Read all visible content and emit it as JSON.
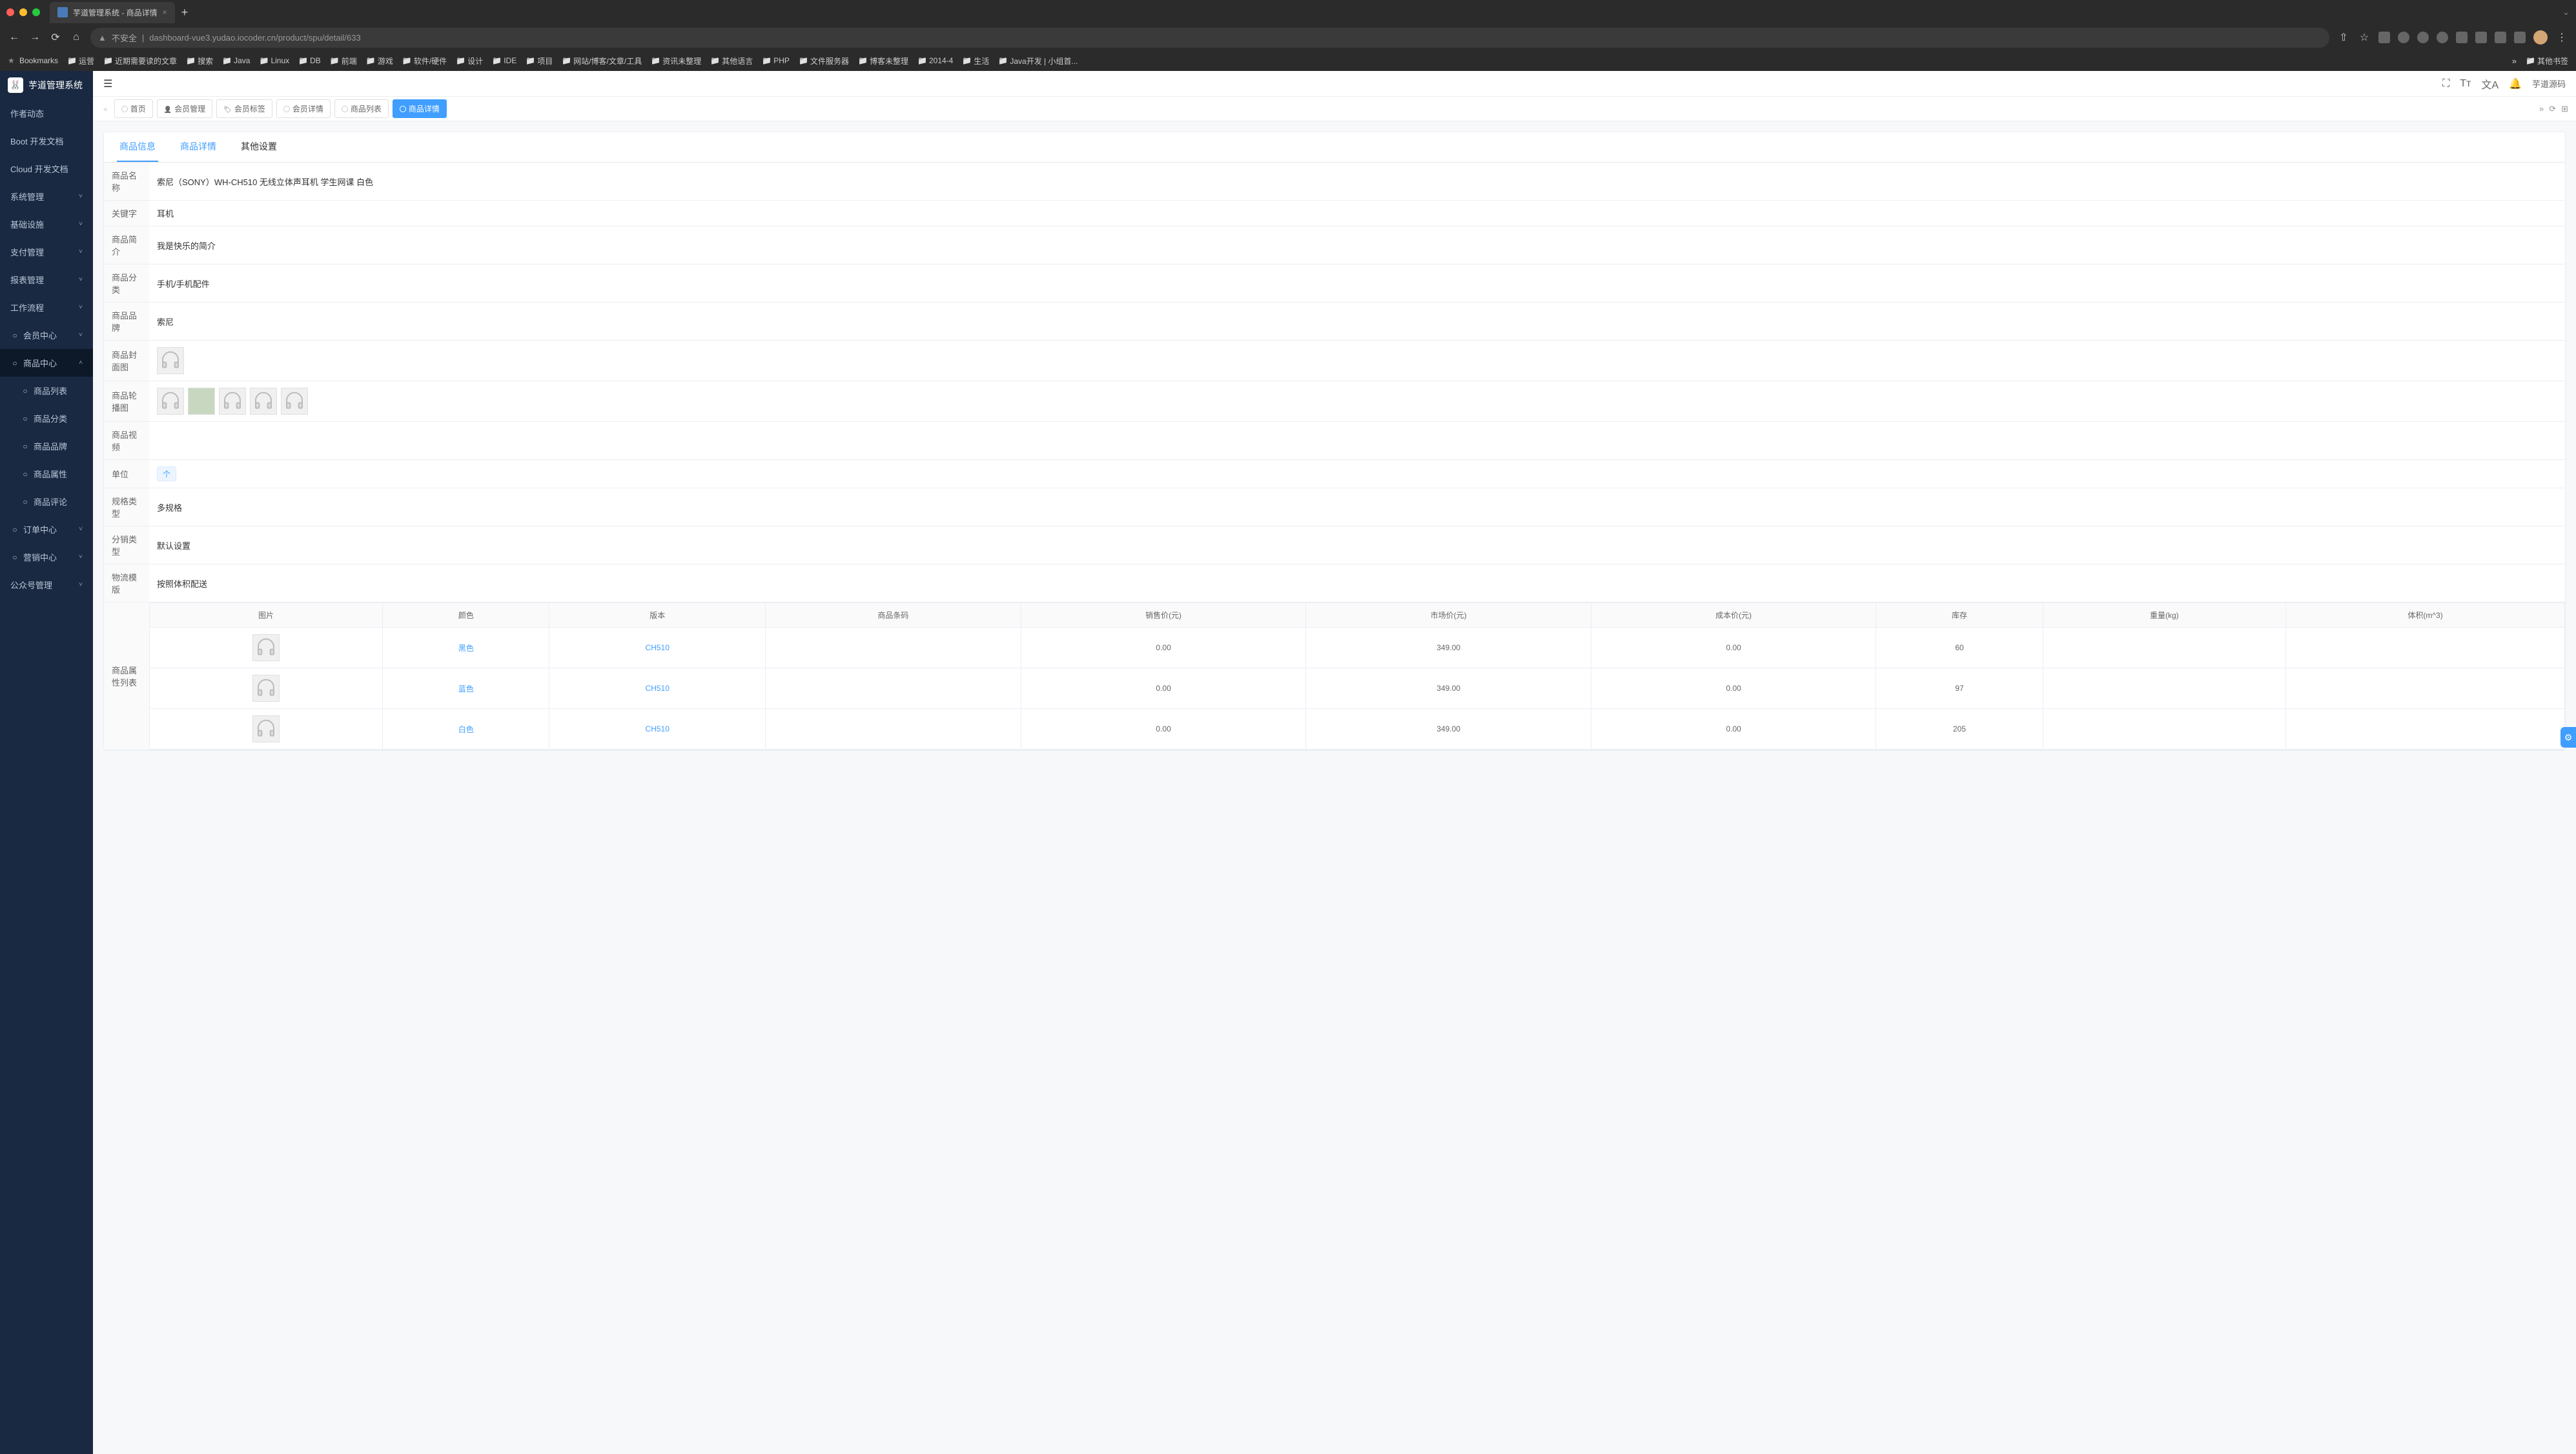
{
  "browser": {
    "tab_title": "芋道管理系统 - 商品详情",
    "url_insecure_label": "不安全",
    "url": "dashboard-vue3.yudao.iocoder.cn/product/spu/detail/633",
    "bookmarks": [
      "Bookmarks",
      "运营",
      "近期需要读的文章",
      "搜索",
      "Java",
      "Linux",
      "DB",
      "前端",
      "游戏",
      "软件/硬件",
      "设计",
      "IDE",
      "项目",
      "网站/博客/文章/工具",
      "资讯未整理",
      "其他语言",
      "PHP",
      "文件服务器",
      "博客未整理",
      "2014-4",
      "生活",
      "Java开发 | 小组首...",
      "其他书签"
    ]
  },
  "app": {
    "title": "芋道管理系统",
    "source_link": "芋道源码"
  },
  "sidebar": {
    "items": [
      {
        "label": "作者动态",
        "type": "item"
      },
      {
        "label": "Boot 开发文档",
        "type": "item"
      },
      {
        "label": "Cloud 开发文档",
        "type": "item"
      },
      {
        "label": "系统管理",
        "type": "group"
      },
      {
        "label": "基础设施",
        "type": "group"
      },
      {
        "label": "支付管理",
        "type": "group"
      },
      {
        "label": "报表管理",
        "type": "group"
      },
      {
        "label": "工作流程",
        "type": "group"
      },
      {
        "label": "会员中心",
        "type": "group",
        "icon": "link"
      },
      {
        "label": "商品中心",
        "type": "group",
        "icon": "P",
        "expanded": true
      },
      {
        "label": "商品列表",
        "type": "sub",
        "icon": "list"
      },
      {
        "label": "商品分类",
        "type": "sub",
        "icon": "cat"
      },
      {
        "label": "商品品牌",
        "type": "sub",
        "icon": "brand"
      },
      {
        "label": "商品属性",
        "type": "sub",
        "icon": "attr"
      },
      {
        "label": "商品评论",
        "type": "sub",
        "icon": "comment"
      },
      {
        "label": "订单中心",
        "type": "group",
        "icon": "order"
      },
      {
        "label": "营销中心",
        "type": "group",
        "icon": "market"
      },
      {
        "label": "公众号管理",
        "type": "group"
      }
    ]
  },
  "tag_tabs": [
    "首页",
    "会员管理",
    "会员标签",
    "会员详情",
    "商品列表",
    "商品详情"
  ],
  "content_tabs": [
    "商品信息",
    "商品详情",
    "其他设置"
  ],
  "product": {
    "labels": {
      "name": "商品名称",
      "keyword": "关键字",
      "intro": "商品简介",
      "category": "商品分类",
      "brand": "商品品牌",
      "cover": "商品封面图",
      "carousel": "商品轮播图",
      "video": "商品视频",
      "unit": "单位",
      "spec_type": "规格类型",
      "dist_type": "分销类型",
      "shipping": "物流模版",
      "sku_list": "商品属性列表"
    },
    "name": "索尼（SONY）WH-CH510 无线立体声耳机 学生网课 白色",
    "keyword": "耳机",
    "intro": "我是快乐的简介",
    "category": "手机/手机配件",
    "brand": "索尼",
    "unit": "个",
    "spec_type": "多规格",
    "dist_type": "默认设置",
    "shipping": "按照体积配送",
    "carousel_count": 5
  },
  "sku_table": {
    "headers": [
      "图片",
      "颜色",
      "版本",
      "商品条码",
      "销售价(元)",
      "市场价(元)",
      "成本价(元)",
      "库存",
      "重量(kg)",
      "体积(m^3)"
    ],
    "rows": [
      {
        "color": "黑色",
        "version": "CH510",
        "barcode": "",
        "sale": "0.00",
        "market": "349.00",
        "cost": "0.00",
        "stock": "60",
        "weight": "",
        "volume": ""
      },
      {
        "color": "蓝色",
        "version": "CH510",
        "barcode": "",
        "sale": "0.00",
        "market": "349.00",
        "cost": "0.00",
        "stock": "97",
        "weight": "",
        "volume": ""
      },
      {
        "color": "白色",
        "version": "CH510",
        "barcode": "",
        "sale": "0.00",
        "market": "349.00",
        "cost": "0.00",
        "stock": "205",
        "weight": "",
        "volume": ""
      }
    ]
  }
}
